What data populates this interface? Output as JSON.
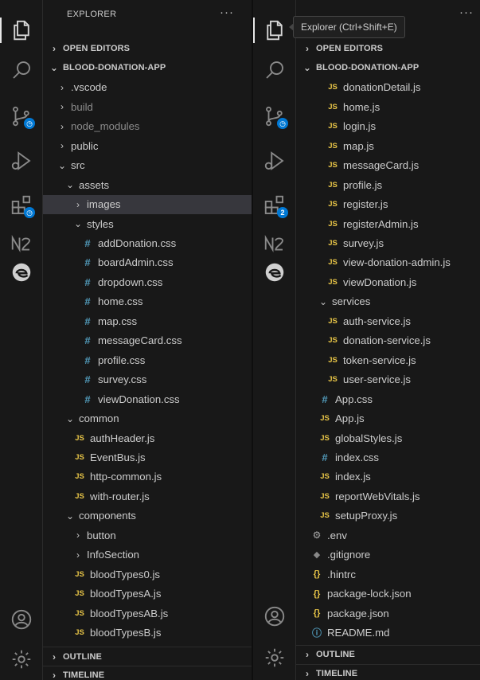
{
  "left": {
    "explorer_title": "EXPLORER",
    "more_actions": "···",
    "rows": [
      {
        "label": "OPEN EDITORS",
        "type": "section",
        "chev": "›",
        "depth": 0
      },
      {
        "label": "BLOOD-DONATION-APP",
        "type": "section",
        "chev": "⌄",
        "depth": 0
      },
      {
        "label": ".vscode",
        "type": "folder",
        "chev": "›",
        "depth": 1
      },
      {
        "label": "build",
        "type": "folder",
        "chev": "›",
        "depth": 1,
        "dim": true
      },
      {
        "label": "node_modules",
        "type": "folder",
        "chev": "›",
        "depth": 1,
        "dim": true
      },
      {
        "label": "public",
        "type": "folder",
        "chev": "›",
        "depth": 1
      },
      {
        "label": "src",
        "type": "folder",
        "chev": "⌄",
        "depth": 1
      },
      {
        "label": "assets",
        "type": "folder",
        "chev": "⌄",
        "depth": 2
      },
      {
        "label": "images",
        "type": "folder",
        "chev": "›",
        "depth": 3,
        "selected": true
      },
      {
        "label": "styles",
        "type": "folder",
        "chev": "⌄",
        "depth": 3
      },
      {
        "label": "addDonation.css",
        "type": "css",
        "depth": 4
      },
      {
        "label": "boardAdmin.css",
        "type": "css",
        "depth": 4
      },
      {
        "label": "dropdown.css",
        "type": "css",
        "depth": 4
      },
      {
        "label": "home.css",
        "type": "css",
        "depth": 4
      },
      {
        "label": "map.css",
        "type": "css",
        "depth": 4
      },
      {
        "label": "messageCard.css",
        "type": "css",
        "depth": 4
      },
      {
        "label": "profile.css",
        "type": "css",
        "depth": 4
      },
      {
        "label": "survey.css",
        "type": "css",
        "depth": 4
      },
      {
        "label": "viewDonation.css",
        "type": "css",
        "depth": 4
      },
      {
        "label": "common",
        "type": "folder",
        "chev": "⌄",
        "depth": 2
      },
      {
        "label": "authHeader.js",
        "type": "js",
        "depth": 3
      },
      {
        "label": "EventBus.js",
        "type": "js",
        "depth": 3
      },
      {
        "label": "http-common.js",
        "type": "js",
        "depth": 3
      },
      {
        "label": "with-router.js",
        "type": "js",
        "depth": 3
      },
      {
        "label": "components",
        "type": "folder",
        "chev": "⌄",
        "depth": 2
      },
      {
        "label": "button",
        "type": "folder",
        "chev": "›",
        "depth": 3
      },
      {
        "label": "InfoSection",
        "type": "folder",
        "chev": "›",
        "depth": 3
      },
      {
        "label": "bloodTypes0.js",
        "type": "js",
        "depth": 3
      },
      {
        "label": "bloodTypesA.js",
        "type": "js",
        "depth": 3
      },
      {
        "label": "bloodTypesAB.js",
        "type": "js",
        "depth": 3
      },
      {
        "label": "bloodTypesB.js",
        "type": "js",
        "depth": 3
      }
    ],
    "outline": "OUTLINE",
    "timeline": "TIMELINE",
    "scm_badge": ""
  },
  "right": {
    "tooltip": "Explorer (Ctrl+Shift+E)",
    "more_actions": "···",
    "rows": [
      {
        "label": "OPEN EDITORS",
        "type": "section",
        "chev": "›",
        "depth": 0
      },
      {
        "label": "BLOOD-DONATION-APP",
        "type": "section",
        "chev": "⌄",
        "depth": 0
      },
      {
        "label": "donationDetail.js",
        "type": "js",
        "depth": 3
      },
      {
        "label": "home.js",
        "type": "js",
        "depth": 3
      },
      {
        "label": "login.js",
        "type": "js",
        "depth": 3
      },
      {
        "label": "map.js",
        "type": "js",
        "depth": 3
      },
      {
        "label": "messageCard.js",
        "type": "js",
        "depth": 3
      },
      {
        "label": "profile.js",
        "type": "js",
        "depth": 3
      },
      {
        "label": "register.js",
        "type": "js",
        "depth": 3
      },
      {
        "label": "registerAdmin.js",
        "type": "js",
        "depth": 3
      },
      {
        "label": "survey.js",
        "type": "js",
        "depth": 3
      },
      {
        "label": "view-donation-admin.js",
        "type": "js",
        "depth": 3
      },
      {
        "label": "viewDonation.js",
        "type": "js",
        "depth": 3
      },
      {
        "label": "services",
        "type": "folder",
        "chev": "⌄",
        "depth": 2
      },
      {
        "label": "auth-service.js",
        "type": "js",
        "depth": 3
      },
      {
        "label": "donation-service.js",
        "type": "js",
        "depth": 3
      },
      {
        "label": "token-service.js",
        "type": "js",
        "depth": 3
      },
      {
        "label": "user-service.js",
        "type": "js",
        "depth": 3
      },
      {
        "label": "App.css",
        "type": "css",
        "depth": 2
      },
      {
        "label": "App.js",
        "type": "js",
        "depth": 2
      },
      {
        "label": "globalStyles.js",
        "type": "js",
        "depth": 2
      },
      {
        "label": "index.css",
        "type": "css",
        "depth": 2
      },
      {
        "label": "index.js",
        "type": "js",
        "depth": 2
      },
      {
        "label": "reportWebVitals.js",
        "type": "js",
        "depth": 2
      },
      {
        "label": "setupProxy.js",
        "type": "js",
        "depth": 2
      },
      {
        "label": ".env",
        "type": "env",
        "depth": 1
      },
      {
        "label": ".gitignore",
        "type": "git",
        "depth": 1
      },
      {
        "label": ".hintrc",
        "type": "json",
        "depth": 1
      },
      {
        "label": "package-lock.json",
        "type": "json",
        "depth": 1
      },
      {
        "label": "package.json",
        "type": "json",
        "depth": 1
      },
      {
        "label": "README.md",
        "type": "info",
        "depth": 1
      }
    ],
    "outline": "OUTLINE",
    "timeline": "TIMELINE",
    "ext_badge": "2"
  },
  "icons": {
    "js": "JS",
    "css": "#",
    "json": "{}",
    "env": "⚙",
    "git": "◆",
    "info": "ⓘ"
  },
  "colors": {
    "background": "#181818",
    "selected_row": "#37373d",
    "js_icon": "#e8c547",
    "css_icon": "#519aba",
    "badge": "#0078d4"
  }
}
